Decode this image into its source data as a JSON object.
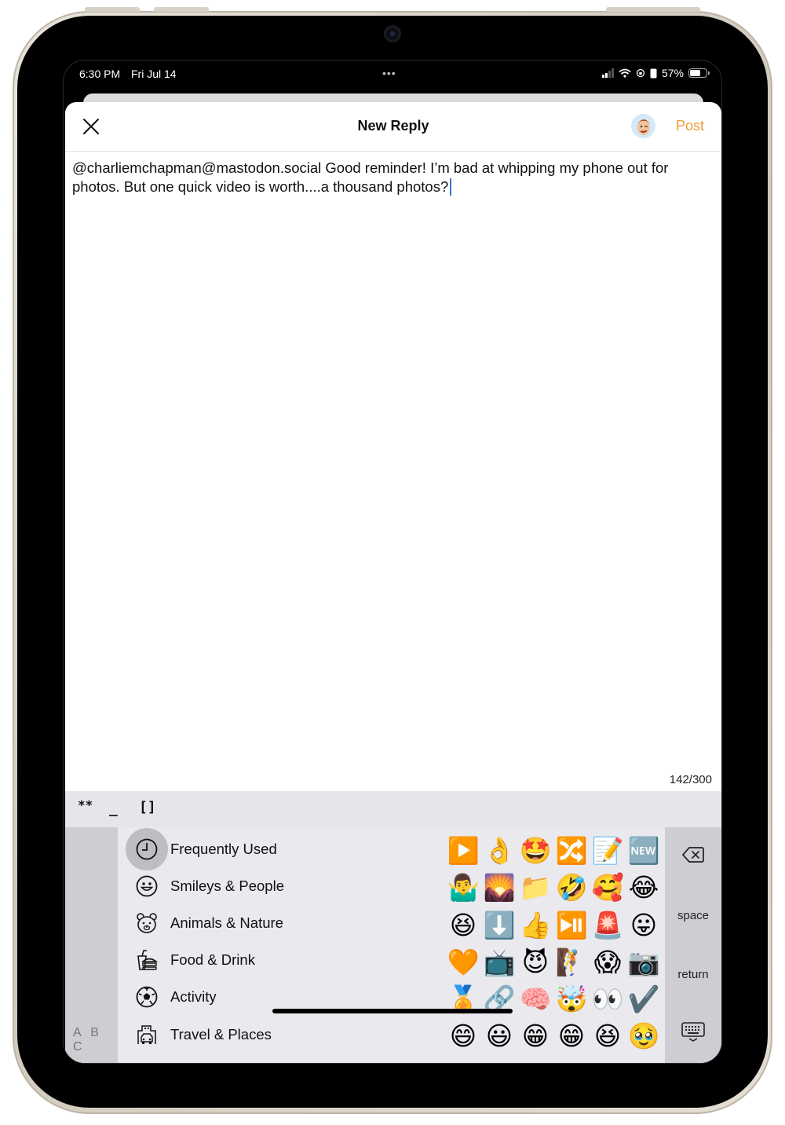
{
  "status_bar": {
    "time": "6:30 PM",
    "date": "Fri Jul 14",
    "multitask_dots": "•••",
    "battery_percent": "57%",
    "battery_level": 0.57
  },
  "nav": {
    "close_icon": "close-icon",
    "title": "New Reply",
    "avatar_icon": "memoji-avatar",
    "post_label": "Post"
  },
  "compose": {
    "text": "@charliemchapman@mastodon.social Good reminder! I’m bad at whipping my phone out for photos. But one quick video is worth....a thousand photos?",
    "char_count": "142/300"
  },
  "markdown_toolbar": {
    "bold": "**",
    "italic": "_",
    "link": "[]"
  },
  "keyboard": {
    "abc_label": "A B C",
    "categories": [
      {
        "label": "Frequently Used",
        "icon": "clock-icon",
        "selected": true
      },
      {
        "label": "Smileys & People",
        "icon": "smiley-icon",
        "selected": false
      },
      {
        "label": "Animals & Nature",
        "icon": "bear-icon",
        "selected": false
      },
      {
        "label": "Food & Drink",
        "icon": "burger-drink-icon",
        "selected": false
      },
      {
        "label": "Activity",
        "icon": "soccer-ball-icon",
        "selected": false
      },
      {
        "label": "Travel & Places",
        "icon": "building-car-icon",
        "selected": false
      }
    ],
    "emojis": [
      "▶️",
      "👌",
      "🤩",
      "🔀",
      "📝",
      "🆕",
      "🤷‍♂️",
      "🌄",
      "📁",
      "🤣",
      "🥰",
      "😂",
      "😆",
      "⬇️",
      "👍",
      "⏯️",
      "🚨",
      "😛",
      "🧡",
      "📺",
      "😈",
      "🧗",
      "😱",
      "📷",
      "🏅",
      "🔗",
      "🧠",
      "🤯",
      "👀",
      "✔️",
      "😄",
      "😃",
      "😁",
      "😁",
      "😆",
      "🥹"
    ],
    "delete_icon": "delete-backspace-icon",
    "space_label": "space",
    "return_label": "return",
    "dismiss_icon": "keyboard-dismiss-icon"
  }
}
